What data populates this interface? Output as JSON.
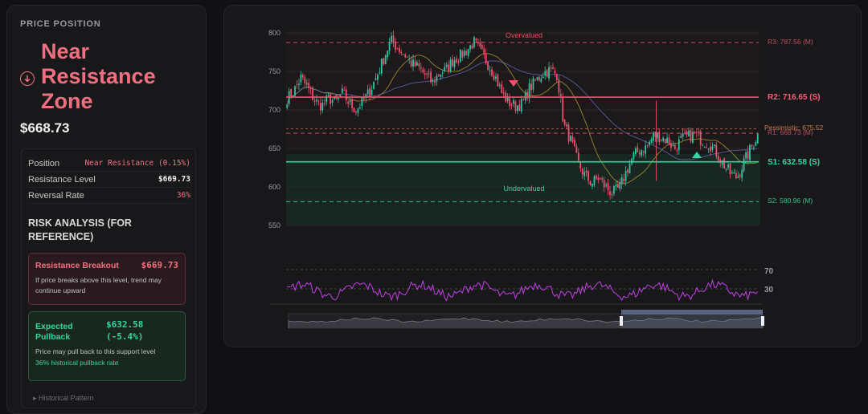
{
  "left_panel": {
    "section_title": "PRICE POSITION",
    "zone_label": "Near Resistance Zone",
    "current_price": "$668.73",
    "rows": [
      {
        "key": "Position",
        "value": "Near Resistance (0.15%)"
      },
      {
        "key": "Resistance Level",
        "value": "$669.73"
      },
      {
        "key": "Reversal Rate",
        "value": "36%"
      }
    ],
    "risk_title": "RISK ANALYSIS (FOR REFERENCE)",
    "breakout_card": {
      "title": "Resistance Breakout",
      "value": "$669.73",
      "desc": "If price breaks above this level, trend may continue upward"
    },
    "pullback_card": {
      "title": "Expected Pullback",
      "value": "$632.58",
      "pct": "(-5.4%)",
      "desc": "Price may pull back to this support level",
      "note": "36% historical pullback rate"
    },
    "historical_label": "▸ Historical Pattern"
  },
  "chart": {
    "y_ticks": [
      "800",
      "750",
      "700",
      "650",
      "600",
      "550"
    ],
    "overvalued_label": "Overvalued",
    "undervalued_label": "Undervalued",
    "r3_label": "R3: 787.56 (M)",
    "r2_label": "R2: 716.65 (S)",
    "pessimistic_label": "Pessimistic: 675.52",
    "r1_label": "R1: 669.73 (M)",
    "s1_label": "S1: 632.58 (S)",
    "s2_label": "S2: 580.96 (M)",
    "rsi_70": "70",
    "rsi_30": "30",
    "colors": {
      "up": "#2ec4a0",
      "down": "#f0506e",
      "resistance": "#f0506e",
      "support": "#33d6a0",
      "rsi": "#c040e0"
    }
  },
  "chart_data": {
    "type": "candlestick",
    "ylim": [
      550,
      805
    ],
    "levels": {
      "R3": 787.56,
      "R2": 716.65,
      "pessimistic": 675.52,
      "R1": 669.73,
      "S1": 632.58,
      "S2": 580.96
    },
    "close_path": [
      715,
      725,
      742,
      728,
      712,
      705,
      715,
      710,
      722,
      708,
      700,
      712,
      725,
      745,
      768,
      790,
      780,
      772,
      760,
      755,
      745,
      735,
      748,
      752,
      765,
      770,
      778,
      788,
      775,
      760,
      745,
      722,
      710,
      705,
      708,
      728,
      738,
      748,
      752,
      746,
      680,
      660,
      632,
      615,
      605,
      612,
      600,
      592,
      598,
      620,
      640,
      648,
      652,
      668,
      665,
      660,
      650,
      662,
      666,
      668,
      660,
      656,
      645,
      630,
      618,
      612,
      632,
      650,
      668
    ],
    "rsi_levels": [
      70,
      30
    ]
  }
}
